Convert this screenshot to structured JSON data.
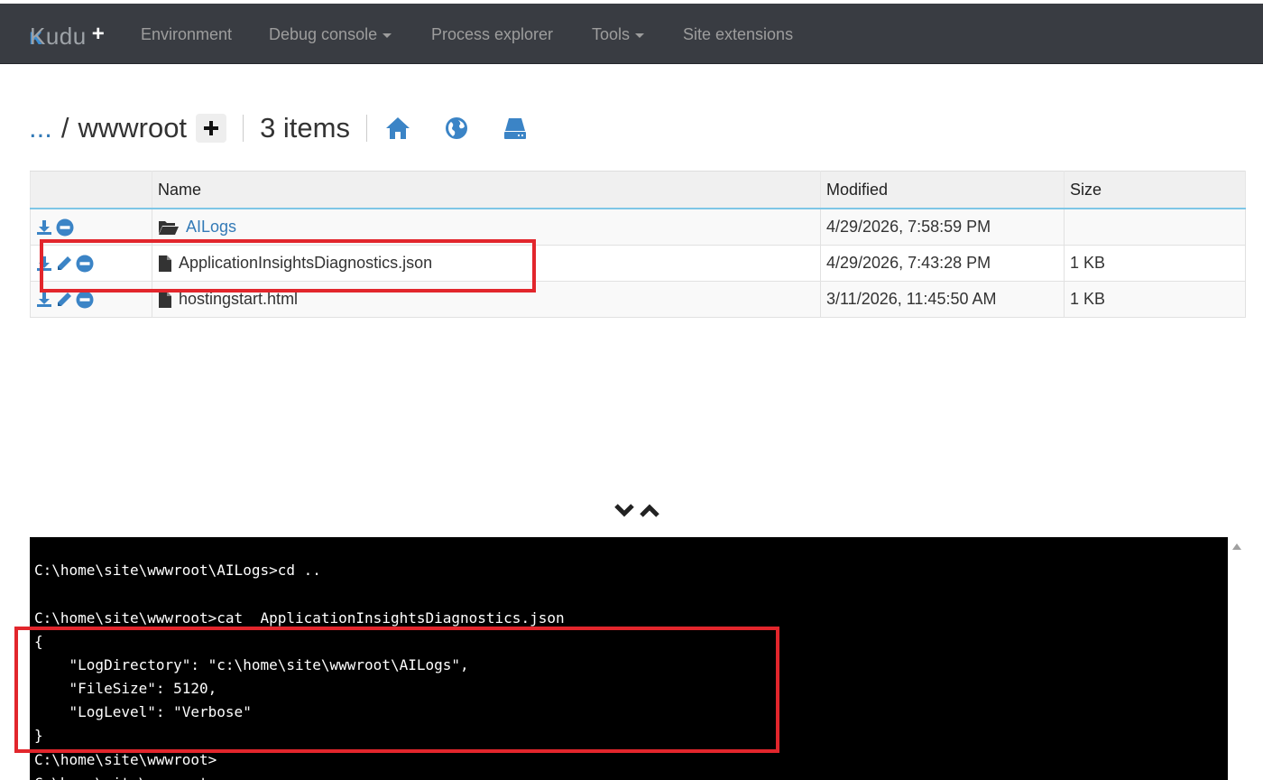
{
  "nav": {
    "brand": "Kudu",
    "brand_plus": "+",
    "items": [
      {
        "label": "Environment",
        "dropdown": false
      },
      {
        "label": "Debug console",
        "dropdown": true
      },
      {
        "label": "Process explorer",
        "dropdown": false
      },
      {
        "label": "Tools",
        "dropdown": true
      },
      {
        "label": "Site extensions",
        "dropdown": false
      }
    ]
  },
  "breadcrumb": {
    "ellipsis": "...",
    "separator": "/",
    "folder": "wwwroot",
    "count": "3 items",
    "icons": [
      "plus-icon",
      "home-icon",
      "globe-icon",
      "drive-icon"
    ]
  },
  "table": {
    "headers": [
      "Name",
      "Modified",
      "Size"
    ],
    "rows": [
      {
        "name": "AILogs",
        "type": "folder",
        "modified": "4/29/2026, 7:58:59 PM",
        "size": ""
      },
      {
        "name": "ApplicationInsightsDiagnostics.json",
        "type": "file",
        "modified": "4/29/2026, 7:43:28 PM",
        "size": "1 KB"
      },
      {
        "name": "hostingstart.html",
        "type": "file",
        "modified": "3/11/2026, 11:45:50 AM",
        "size": "1 KB"
      }
    ]
  },
  "console": {
    "lines": [
      "C:\\home\\site\\wwwroot\\AILogs>cd ..",
      "",
      "C:\\home\\site\\wwwroot>cat  ApplicationInsightsDiagnostics.json",
      "{",
      "    \"LogDirectory\": \"c:\\home\\site\\wwwroot\\AILogs\",",
      "    \"FileSize\": 5120,",
      "    \"LogLevel\": \"Verbose\"",
      "}",
      "C:\\home\\site\\wwwroot>",
      "C:\\home\\site\\wwwroot>"
    ]
  },
  "colors": {
    "navbar": "#393c42",
    "accent_blue": "#337ab7",
    "highlight_red": "#e2262c",
    "console_bg": "#000000"
  }
}
